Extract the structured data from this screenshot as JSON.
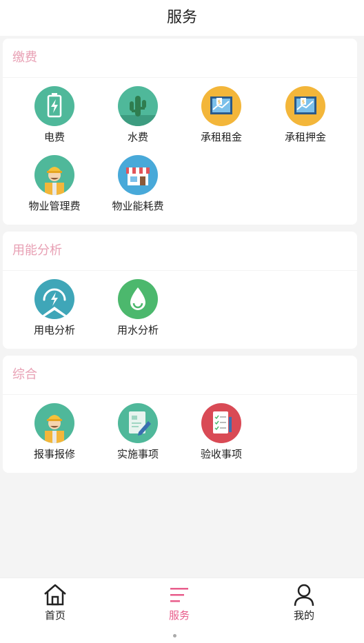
{
  "header": {
    "title": "服务"
  },
  "sections": [
    {
      "title": "缴费",
      "items": [
        {
          "label": "电费",
          "icon": "battery-icon",
          "color": "#4fb89a"
        },
        {
          "label": "水费",
          "icon": "cactus-icon",
          "color": "#4fb89a"
        },
        {
          "label": "承租租金",
          "icon": "chart-money-icon",
          "color": "#f3b63a"
        },
        {
          "label": "承租押金",
          "icon": "chart-money-icon",
          "color": "#f3b63a"
        },
        {
          "label": "物业管理费",
          "icon": "worker-icon",
          "color": "#4fb89a"
        },
        {
          "label": "物业能耗费",
          "icon": "store-icon",
          "color": "#48a9d9"
        }
      ]
    },
    {
      "title": "用能分析",
      "items": [
        {
          "label": "用电分析",
          "icon": "lightning-icon",
          "color": "#3fa6b8"
        },
        {
          "label": "用水分析",
          "icon": "water-drop-icon",
          "color": "#4cb86d"
        }
      ]
    },
    {
      "title": "综合",
      "items": [
        {
          "label": "报事报修",
          "icon": "worker-icon",
          "color": "#4fb89a"
        },
        {
          "label": "实施事项",
          "icon": "document-edit-icon",
          "color": "#4fb89a"
        },
        {
          "label": "验收事项",
          "icon": "checklist-icon",
          "color": "#d94a55"
        }
      ]
    }
  ],
  "tabbar": [
    {
      "label": "首页",
      "icon": "home-icon",
      "active": false
    },
    {
      "label": "服务",
      "icon": "menu-lines-icon",
      "active": true
    },
    {
      "label": "我的",
      "icon": "user-icon",
      "active": false
    }
  ],
  "colors": {
    "accent": "#e85c8b",
    "section_title": "#e8a0b4"
  }
}
